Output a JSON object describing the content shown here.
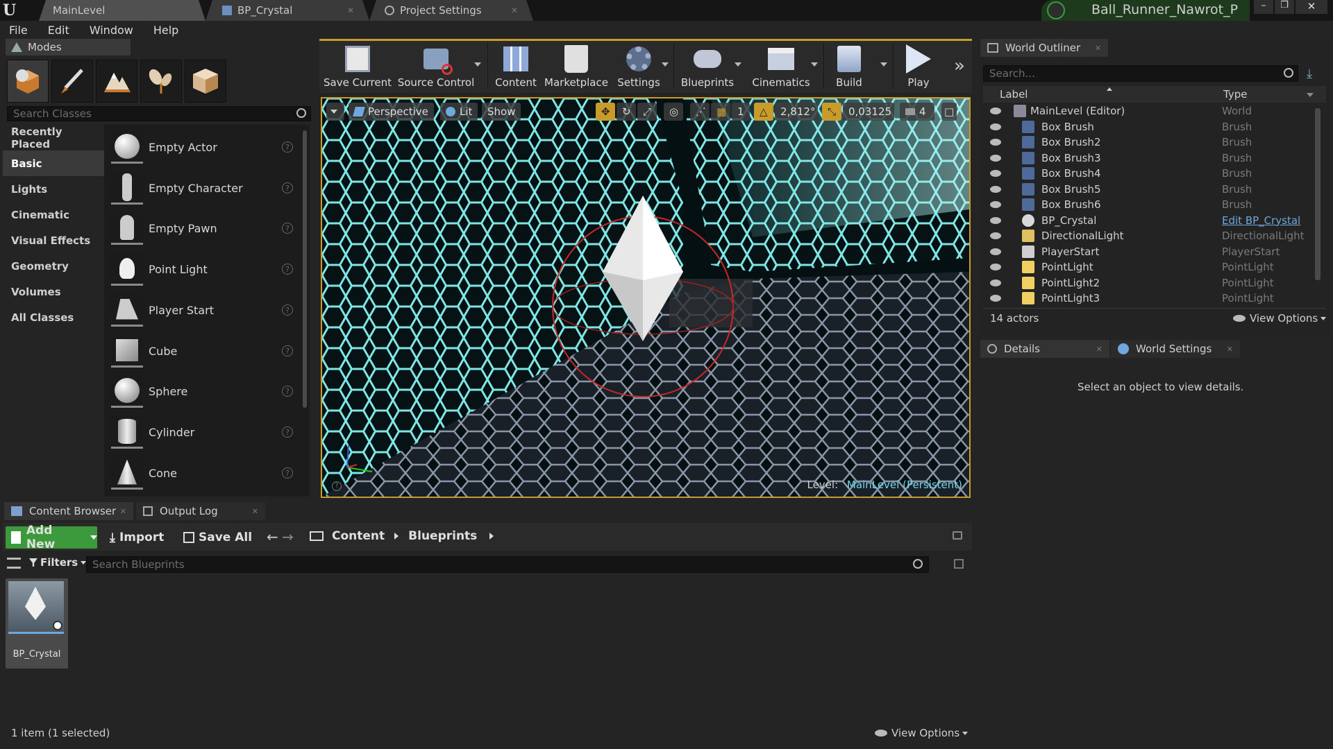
{
  "window": {
    "tabs": [
      {
        "label": "MainLevel",
        "active": true
      },
      {
        "label": "BP_Crystal",
        "active": false
      },
      {
        "label": "Project Settings",
        "active": false
      }
    ],
    "project_name": "Ball_Runner_Nawrot_P"
  },
  "menu": [
    "File",
    "Edit",
    "Window",
    "Help"
  ],
  "modes": {
    "tab_label": "Modes",
    "mode_icons": [
      "place-mode-icon",
      "paint-mode-icon",
      "landscape-mode-icon",
      "foliage-mode-icon",
      "geometry-edit-mode-icon"
    ],
    "search_placeholder": "Search Classes",
    "categories": [
      "Recently Placed",
      "Basic",
      "Lights",
      "Cinematic",
      "Visual Effects",
      "Geometry",
      "Volumes",
      "All Classes"
    ],
    "active_category": "Basic",
    "items": [
      "Empty Actor",
      "Empty Character",
      "Empty Pawn",
      "Point Light",
      "Player Start",
      "Cube",
      "Sphere",
      "Cylinder",
      "Cone"
    ]
  },
  "toolbar": {
    "items": [
      "Save Current",
      "Source Control",
      "Content",
      "Marketplace",
      "Settings",
      "Blueprints",
      "Cinematics",
      "Build",
      "Play"
    ]
  },
  "viewport": {
    "view_mode": "Perspective",
    "lighting": "Lit",
    "show": "Show",
    "rotation_snap": "2,812°",
    "scale_snap": "0,03125",
    "camera_speed": "4",
    "grid_value": "1",
    "level_prefix": "Level:",
    "level_name": "MainLevel (Persistent)"
  },
  "outliner": {
    "tab_label": "World Outliner",
    "search_placeholder": "Search...",
    "col_label": "Label",
    "col_type": "Type",
    "rows": [
      {
        "label": "MainLevel (Editor)",
        "type": "World"
      },
      {
        "label": "Box Brush",
        "type": "Brush"
      },
      {
        "label": "Box Brush2",
        "type": "Brush"
      },
      {
        "label": "Box Brush3",
        "type": "Brush"
      },
      {
        "label": "Box Brush4",
        "type": "Brush"
      },
      {
        "label": "Box Brush5",
        "type": "Brush"
      },
      {
        "label": "Box Brush6",
        "type": "Brush"
      },
      {
        "label": "BP_Crystal",
        "type": "Edit BP_Crystal"
      },
      {
        "label": "DirectionalLight",
        "type": "DirectionalLight"
      },
      {
        "label": "PlayerStart",
        "type": "PlayerStart"
      },
      {
        "label": "PointLight",
        "type": "PointLight"
      },
      {
        "label": "PointLight2",
        "type": "PointLight"
      },
      {
        "label": "PointLight3",
        "type": "PointLight"
      }
    ],
    "actor_count": "14 actors",
    "view_options": "View Options"
  },
  "details": {
    "tab_details": "Details",
    "tab_world_settings": "World Settings",
    "empty_message": "Select an object to view details."
  },
  "content_browser": {
    "tab_label": "Content Browser",
    "tab_output_log": "Output Log",
    "add_new": "Add New",
    "import": "Import",
    "save_all": "Save All",
    "path": [
      "Content",
      "Blueprints"
    ],
    "filters": "Filters",
    "search_placeholder": "Search Blueprints",
    "assets": [
      {
        "name": "BP_Crystal"
      }
    ],
    "status": "1 item (1 selected)",
    "view_options": "View Options"
  },
  "colors": {
    "accent": "#c89b2a",
    "add_new_green": "#3c9a3c",
    "link_blue": "#6fa8dc"
  }
}
